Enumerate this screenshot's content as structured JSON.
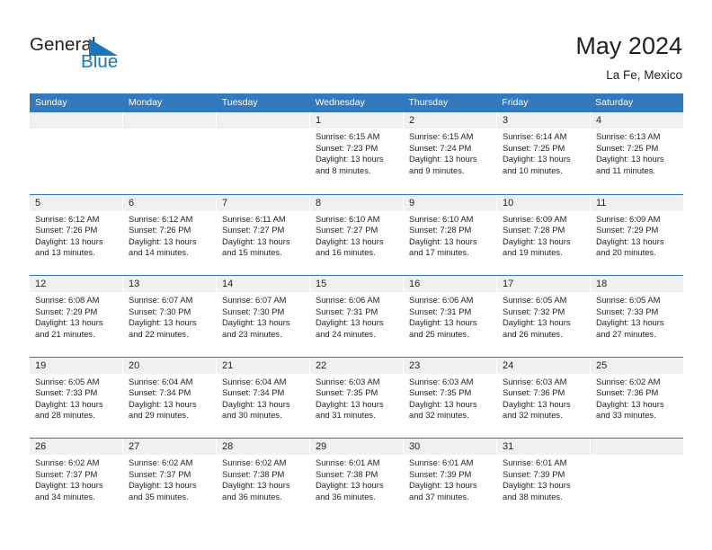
{
  "brand": {
    "name_part1": "General",
    "name_part2": "Blue",
    "accent_color": "#1b75bb",
    "triangle_icon": "right-triangle-icon"
  },
  "header": {
    "title": "May 2024",
    "subtitle": "La Fe, Mexico"
  },
  "theme": {
    "header_bar": "#3279bd",
    "day_band": "#f0f0f0",
    "text": "#231f20"
  },
  "weekdays": [
    "Sunday",
    "Monday",
    "Tuesday",
    "Wednesday",
    "Thursday",
    "Friday",
    "Saturday"
  ],
  "weeks": [
    [
      {
        "day": "",
        "empty": true
      },
      {
        "day": "",
        "empty": true
      },
      {
        "day": "",
        "empty": true
      },
      {
        "day": "1",
        "sunrise": "Sunrise: 6:15 AM",
        "sunset": "Sunset: 7:23 PM",
        "daylight1": "Daylight: 13 hours",
        "daylight2": "and 8 minutes."
      },
      {
        "day": "2",
        "sunrise": "Sunrise: 6:15 AM",
        "sunset": "Sunset: 7:24 PM",
        "daylight1": "Daylight: 13 hours",
        "daylight2": "and 9 minutes."
      },
      {
        "day": "3",
        "sunrise": "Sunrise: 6:14 AM",
        "sunset": "Sunset: 7:25 PM",
        "daylight1": "Daylight: 13 hours",
        "daylight2": "and 10 minutes."
      },
      {
        "day": "4",
        "sunrise": "Sunrise: 6:13 AM",
        "sunset": "Sunset: 7:25 PM",
        "daylight1": "Daylight: 13 hours",
        "daylight2": "and 11 minutes."
      }
    ],
    [
      {
        "day": "5",
        "sunrise": "Sunrise: 6:12 AM",
        "sunset": "Sunset: 7:26 PM",
        "daylight1": "Daylight: 13 hours",
        "daylight2": "and 13 minutes."
      },
      {
        "day": "6",
        "sunrise": "Sunrise: 6:12 AM",
        "sunset": "Sunset: 7:26 PM",
        "daylight1": "Daylight: 13 hours",
        "daylight2": "and 14 minutes."
      },
      {
        "day": "7",
        "sunrise": "Sunrise: 6:11 AM",
        "sunset": "Sunset: 7:27 PM",
        "daylight1": "Daylight: 13 hours",
        "daylight2": "and 15 minutes."
      },
      {
        "day": "8",
        "sunrise": "Sunrise: 6:10 AM",
        "sunset": "Sunset: 7:27 PM",
        "daylight1": "Daylight: 13 hours",
        "daylight2": "and 16 minutes."
      },
      {
        "day": "9",
        "sunrise": "Sunrise: 6:10 AM",
        "sunset": "Sunset: 7:28 PM",
        "daylight1": "Daylight: 13 hours",
        "daylight2": "and 17 minutes."
      },
      {
        "day": "10",
        "sunrise": "Sunrise: 6:09 AM",
        "sunset": "Sunset: 7:28 PM",
        "daylight1": "Daylight: 13 hours",
        "daylight2": "and 19 minutes."
      },
      {
        "day": "11",
        "sunrise": "Sunrise: 6:09 AM",
        "sunset": "Sunset: 7:29 PM",
        "daylight1": "Daylight: 13 hours",
        "daylight2": "and 20 minutes."
      }
    ],
    [
      {
        "day": "12",
        "sunrise": "Sunrise: 6:08 AM",
        "sunset": "Sunset: 7:29 PM",
        "daylight1": "Daylight: 13 hours",
        "daylight2": "and 21 minutes."
      },
      {
        "day": "13",
        "sunrise": "Sunrise: 6:07 AM",
        "sunset": "Sunset: 7:30 PM",
        "daylight1": "Daylight: 13 hours",
        "daylight2": "and 22 minutes."
      },
      {
        "day": "14",
        "sunrise": "Sunrise: 6:07 AM",
        "sunset": "Sunset: 7:30 PM",
        "daylight1": "Daylight: 13 hours",
        "daylight2": "and 23 minutes."
      },
      {
        "day": "15",
        "sunrise": "Sunrise: 6:06 AM",
        "sunset": "Sunset: 7:31 PM",
        "daylight1": "Daylight: 13 hours",
        "daylight2": "and 24 minutes."
      },
      {
        "day": "16",
        "sunrise": "Sunrise: 6:06 AM",
        "sunset": "Sunset: 7:31 PM",
        "daylight1": "Daylight: 13 hours",
        "daylight2": "and 25 minutes."
      },
      {
        "day": "17",
        "sunrise": "Sunrise: 6:05 AM",
        "sunset": "Sunset: 7:32 PM",
        "daylight1": "Daylight: 13 hours",
        "daylight2": "and 26 minutes."
      },
      {
        "day": "18",
        "sunrise": "Sunrise: 6:05 AM",
        "sunset": "Sunset: 7:33 PM",
        "daylight1": "Daylight: 13 hours",
        "daylight2": "and 27 minutes."
      }
    ],
    [
      {
        "day": "19",
        "sunrise": "Sunrise: 6:05 AM",
        "sunset": "Sunset: 7:33 PM",
        "daylight1": "Daylight: 13 hours",
        "daylight2": "and 28 minutes."
      },
      {
        "day": "20",
        "sunrise": "Sunrise: 6:04 AM",
        "sunset": "Sunset: 7:34 PM",
        "daylight1": "Daylight: 13 hours",
        "daylight2": "and 29 minutes."
      },
      {
        "day": "21",
        "sunrise": "Sunrise: 6:04 AM",
        "sunset": "Sunset: 7:34 PM",
        "daylight1": "Daylight: 13 hours",
        "daylight2": "and 30 minutes."
      },
      {
        "day": "22",
        "sunrise": "Sunrise: 6:03 AM",
        "sunset": "Sunset: 7:35 PM",
        "daylight1": "Daylight: 13 hours",
        "daylight2": "and 31 minutes."
      },
      {
        "day": "23",
        "sunrise": "Sunrise: 6:03 AM",
        "sunset": "Sunset: 7:35 PM",
        "daylight1": "Daylight: 13 hours",
        "daylight2": "and 32 minutes."
      },
      {
        "day": "24",
        "sunrise": "Sunrise: 6:03 AM",
        "sunset": "Sunset: 7:36 PM",
        "daylight1": "Daylight: 13 hours",
        "daylight2": "and 32 minutes."
      },
      {
        "day": "25",
        "sunrise": "Sunrise: 6:02 AM",
        "sunset": "Sunset: 7:36 PM",
        "daylight1": "Daylight: 13 hours",
        "daylight2": "and 33 minutes."
      }
    ],
    [
      {
        "day": "26",
        "sunrise": "Sunrise: 6:02 AM",
        "sunset": "Sunset: 7:37 PM",
        "daylight1": "Daylight: 13 hours",
        "daylight2": "and 34 minutes."
      },
      {
        "day": "27",
        "sunrise": "Sunrise: 6:02 AM",
        "sunset": "Sunset: 7:37 PM",
        "daylight1": "Daylight: 13 hours",
        "daylight2": "and 35 minutes."
      },
      {
        "day": "28",
        "sunrise": "Sunrise: 6:02 AM",
        "sunset": "Sunset: 7:38 PM",
        "daylight1": "Daylight: 13 hours",
        "daylight2": "and 36 minutes."
      },
      {
        "day": "29",
        "sunrise": "Sunrise: 6:01 AM",
        "sunset": "Sunset: 7:38 PM",
        "daylight1": "Daylight: 13 hours",
        "daylight2": "and 36 minutes."
      },
      {
        "day": "30",
        "sunrise": "Sunrise: 6:01 AM",
        "sunset": "Sunset: 7:39 PM",
        "daylight1": "Daylight: 13 hours",
        "daylight2": "and 37 minutes."
      },
      {
        "day": "31",
        "sunrise": "Sunrise: 6:01 AM",
        "sunset": "Sunset: 7:39 PM",
        "daylight1": "Daylight: 13 hours",
        "daylight2": "and 38 minutes."
      },
      {
        "day": "",
        "empty": true
      }
    ]
  ]
}
